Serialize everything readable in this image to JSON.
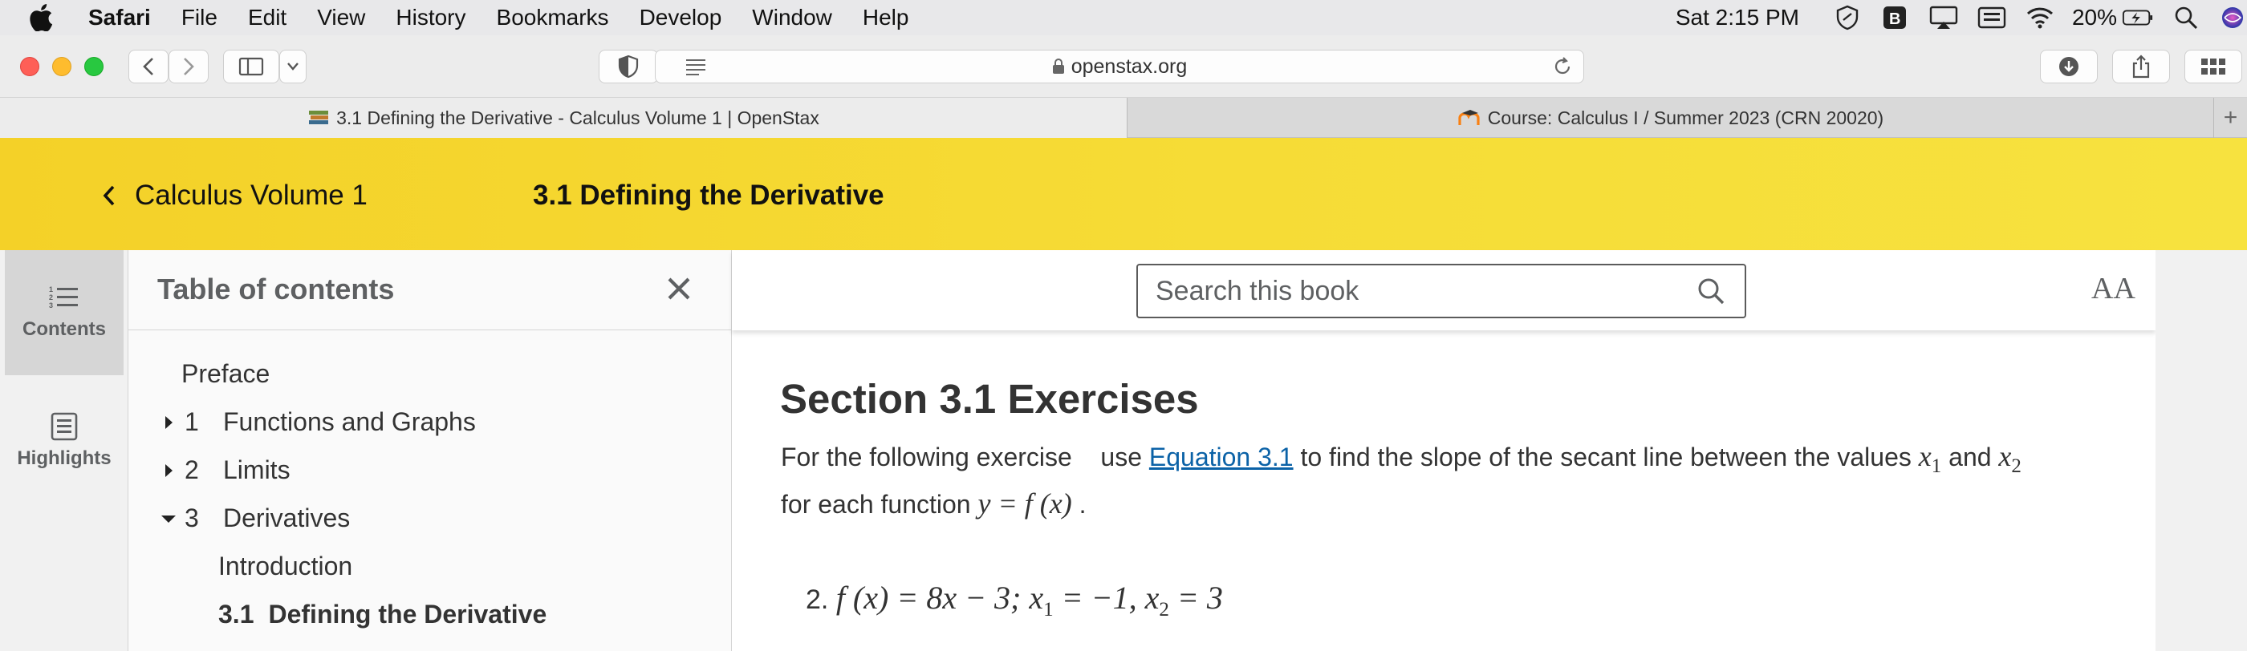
{
  "menubar": {
    "apple": "apple-logo",
    "app_name": "Safari",
    "menus": [
      "File",
      "Edit",
      "View",
      "History",
      "Bookmarks",
      "Develop",
      "Window",
      "Help"
    ],
    "clock": "Sat 2:15 PM",
    "battery_percent": "20%"
  },
  "toolbar": {
    "url": "openstax.org"
  },
  "tabs": [
    {
      "label": "3.1 Defining the Derivative - Calculus Volume 1 | OpenStax",
      "active": true
    },
    {
      "label": "Course: Calculus I / Summer 2023 (CRN 20020)",
      "active": false
    }
  ],
  "book": {
    "back_label": "Calculus Volume 1",
    "current_section": "3.1 Defining the Derivative"
  },
  "sidenav": {
    "contents_label": "Contents",
    "highlights_label": "Highlights"
  },
  "toc": {
    "title": "Table of contents",
    "items": [
      {
        "num": "",
        "label": "Preface"
      },
      {
        "num": "1",
        "label": "Functions and Graphs"
      },
      {
        "num": "2",
        "label": "Limits"
      },
      {
        "num": "3",
        "label": "Derivatives"
      },
      {
        "num": "",
        "label": "Introduction"
      },
      {
        "num": "3.1",
        "label": "Defining the Derivative"
      }
    ]
  },
  "search": {
    "placeholder": "Search this book"
  },
  "text_size_label": "AA",
  "content": {
    "section_title": "Section 3.1 Exercises",
    "intro_before": "For the following exercise",
    "intro_link_prefix": "use",
    "intro_link": "Equation 3.1",
    "intro_after": "to find the slope of the secant line between the values",
    "and_word": "and",
    "for_each": "for",
    "each_function": "each function",
    "exercise_number": "2.",
    "exercise_math": "f (x) = 8x − 3; x1 = −1, x2 = 3"
  },
  "colors": {
    "header_yellow": "#f6dc36",
    "link_blue": "#0b62a7",
    "sidebar_gray": "#f1f1f1"
  }
}
